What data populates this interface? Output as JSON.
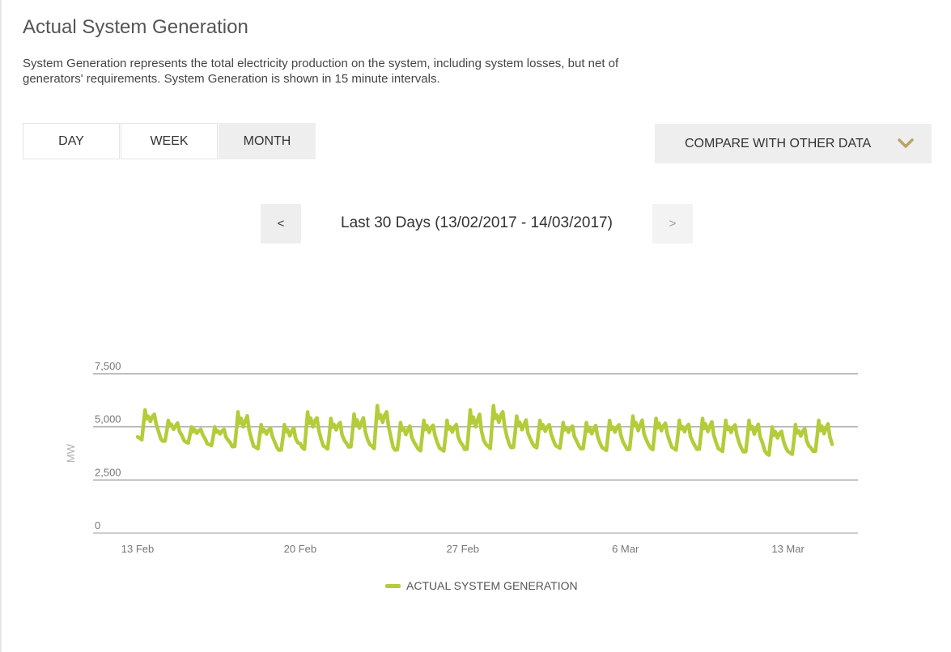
{
  "page": {
    "title": "Actual System Generation",
    "description": "System Generation represents the total electricity production on the system, including system losses, but net of generators' requirements. System Generation is shown in 15 minute intervals."
  },
  "range_tabs": [
    {
      "label": "DAY",
      "active": false
    },
    {
      "label": "WEEK",
      "active": false
    },
    {
      "label": "MONTH",
      "active": true
    }
  ],
  "compare": {
    "label": "COMPARE WITH OTHER DATA",
    "icon": "chevron-down-icon",
    "icon_color": "#b9a36a"
  },
  "period": {
    "prev_label": "<",
    "next_label": ">",
    "label": "Last 30 Days (13/02/2017 - 14/03/2017)"
  },
  "legend": {
    "label": "ACTUAL SYSTEM GENERATION"
  },
  "chart_data": {
    "type": "line",
    "xlabel": "",
    "ylabel": "MW",
    "ylim": [
      0,
      7500
    ],
    "xlim": [
      "2017-02-13",
      "2017-03-14"
    ],
    "y_ticks": [
      0,
      2500,
      5000,
      7500
    ],
    "y_tick_labels": [
      "0",
      "2,500",
      "5,000",
      "7,500"
    ],
    "x_ticks": [
      "2017-02-13",
      "2017-02-20",
      "2017-02-27",
      "2017-03-06",
      "2017-03-13"
    ],
    "x_tick_labels": [
      "13 Feb",
      "20 Feb",
      "27 Feb",
      "6 Mar",
      "13 Mar"
    ],
    "grid": true,
    "legend_position": "bottom-center",
    "series": [
      {
        "name": "ACTUAL SYSTEM GENERATION",
        "color": "#b4cc3a",
        "daily_min": [
          4300,
          4250,
          4200,
          4050,
          3900,
          3900,
          3800,
          3850,
          3850,
          3900,
          3850,
          3800,
          3800,
          3750,
          3750,
          3850,
          3900,
          3950,
          3900,
          3850,
          3800,
          3800,
          3850,
          3800,
          3800,
          3750,
          3700,
          3600,
          3600,
          3700
        ],
        "daily_max": [
          5800,
          5300,
          5000,
          5000,
          5700,
          5100,
          5100,
          5700,
          5400,
          5600,
          6000,
          5200,
          5300,
          5300,
          5800,
          6000,
          5500,
          5300,
          5200,
          5200,
          5300,
          5500,
          5400,
          5300,
          5400,
          5300,
          5300,
          5000,
          5100,
          5300
        ]
      }
    ]
  }
}
